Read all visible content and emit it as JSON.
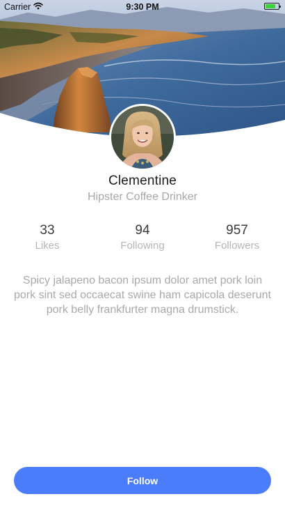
{
  "status_bar": {
    "carrier": "Carrier",
    "time": "9:30 PM",
    "battery_level": 0.8,
    "icons": [
      "wifi-icon",
      "battery-icon"
    ]
  },
  "profile": {
    "name": "Clementine",
    "tagline": "Hipster Coffee Drinker",
    "avatar_icon": "avatar-photo"
  },
  "stats": [
    {
      "value": "33",
      "label": "Likes"
    },
    {
      "value": "94",
      "label": "Following"
    },
    {
      "value": "957",
      "label": "Followers"
    }
  ],
  "bio": "Spicy jalapeno bacon ipsum dolor amet pork loin pork sint sed occaecat swine ham capicola deserunt pork belly frankfurter magna drumstick.",
  "actions": {
    "follow_label": "Follow"
  },
  "colors": {
    "accent": "#4b7dfb",
    "text_primary": "#1b1b1b",
    "text_muted": "#a9a9a9",
    "battery": "#3fd23a"
  }
}
